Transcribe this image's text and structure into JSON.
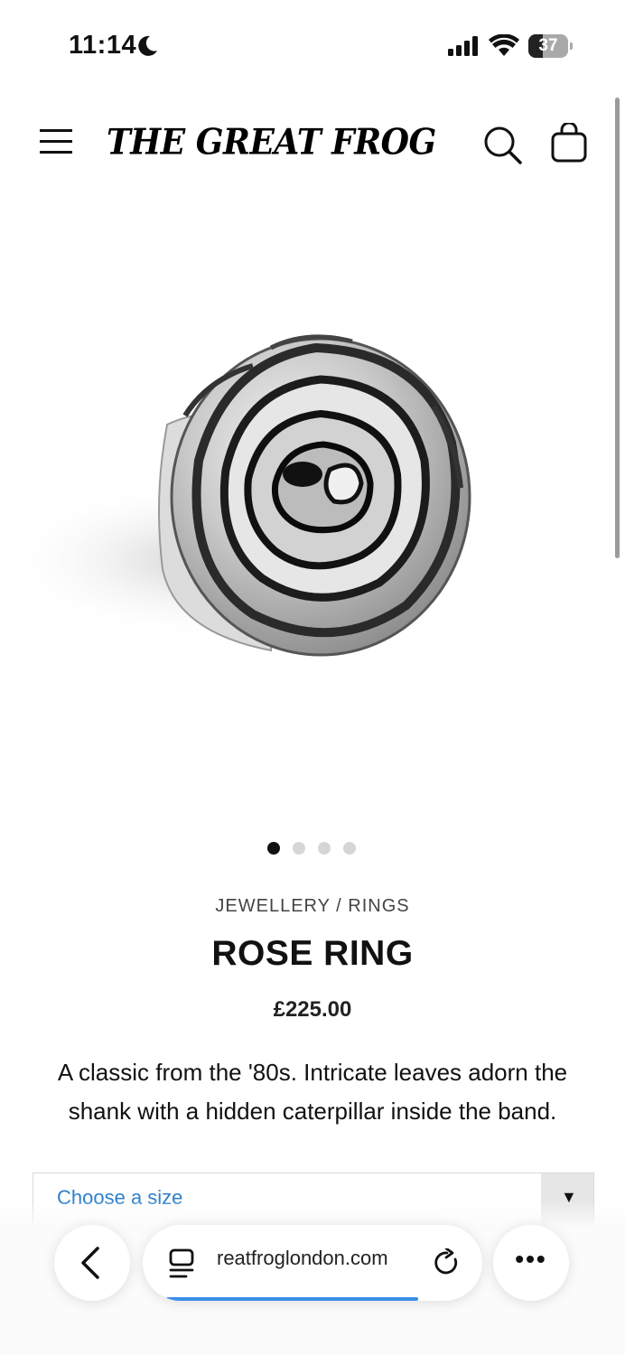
{
  "status_bar": {
    "time": "11:14",
    "battery": "37",
    "battery_level": 0.37
  },
  "header": {
    "logo": "THE GREAT FROG",
    "icons": [
      "menu-icon",
      "search-icon",
      "shopping-bag-icon"
    ]
  },
  "gallery": {
    "image_count": 4,
    "active_index": 0
  },
  "product": {
    "breadcrumb": "JEWELLERY / RINGS",
    "title": "ROSE RING",
    "price": "£225.00",
    "description": "A classic from the '80s. Intricate leaves adorn the shank with a hidden caterpillar inside the band.",
    "size_placeholder": "Choose a size"
  },
  "browser": {
    "url": "reatfroglondon.com",
    "load_progress": 0.86,
    "accent": "#3a8ee6"
  }
}
